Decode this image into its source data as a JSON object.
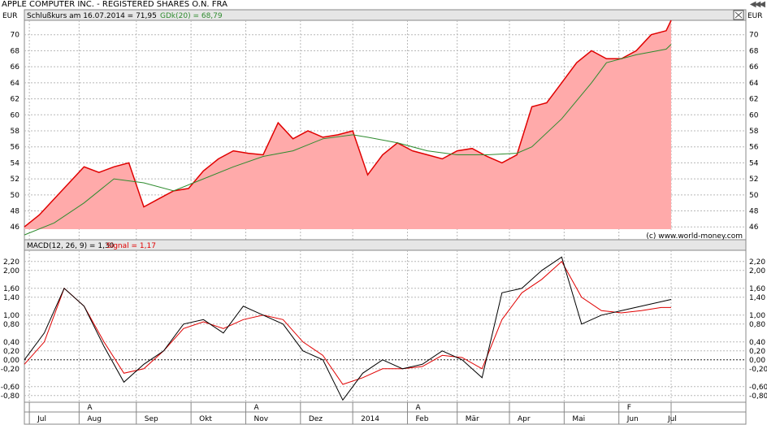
{
  "window": {
    "title": "APPLE COMPUTER INC. - REGISTERED SHARES O.N. FRA"
  },
  "icons": {
    "nav": "triple-chevron-left-icon",
    "close": "close-box-icon"
  },
  "chart_data": [
    {
      "type": "area",
      "currency_label": "EUR",
      "legend": {
        "close_label": "Schlußkurs am 16.07.2014 = 71,95",
        "ma_label": "GDk(20) = 68,79"
      },
      "credit": "(c) www.world-money.com",
      "yticks": [
        "46",
        "48",
        "50",
        "52",
        "54",
        "56",
        "58",
        "60",
        "62",
        "64",
        "66",
        "68",
        "70"
      ],
      "yvalues": [
        46,
        48,
        50,
        52,
        54,
        56,
        58,
        60,
        62,
        64,
        66,
        68,
        70
      ],
      "ylim": [
        44.4,
        71.8
      ],
      "x_index_range": [
        0,
        260
      ],
      "colors": {
        "close_line": "#e00000",
        "close_fill": "#ffaaaa",
        "ma_line": "#2e8b2e"
      },
      "series": [
        {
          "name": "Schlußkurs",
          "x": [
            0,
            6,
            12,
            18,
            24,
            30,
            36,
            42,
            48,
            54,
            60,
            66,
            72,
            78,
            84,
            90,
            96,
            102,
            108,
            114,
            120,
            126,
            132,
            138,
            144,
            150,
            156,
            162,
            168,
            174,
            180,
            186,
            192,
            198,
            204,
            210,
            216,
            222,
            228,
            234,
            240,
            246,
            252,
            258,
            260
          ],
          "values": [
            46.0,
            47.5,
            49.5,
            51.5,
            53.5,
            52.8,
            53.5,
            54.0,
            48.5,
            49.5,
            50.5,
            50.8,
            53.0,
            54.5,
            55.5,
            55.2,
            55.0,
            59.0,
            57.0,
            58.0,
            57.2,
            57.5,
            58.0,
            52.5,
            55.0,
            56.5,
            55.5,
            55.0,
            54.5,
            55.5,
            55.8,
            54.8,
            54.0,
            55.0,
            61.0,
            61.5,
            64.0,
            66.5,
            68.0,
            67.0,
            67.0,
            68.0,
            70.0,
            70.5,
            71.8
          ]
        },
        {
          "name": "GDk(20)",
          "x": [
            0,
            12,
            24,
            36,
            48,
            60,
            72,
            84,
            96,
            108,
            120,
            132,
            138,
            150,
            162,
            174,
            186,
            198,
            204,
            216,
            228,
            234,
            246,
            258,
            260
          ],
          "values": [
            45.0,
            46.5,
            49.0,
            52.0,
            51.5,
            50.5,
            52.0,
            53.5,
            54.8,
            55.5,
            57.0,
            57.5,
            57.2,
            56.5,
            55.5,
            55.0,
            55.0,
            55.2,
            56.0,
            59.5,
            64.0,
            66.5,
            67.5,
            68.2,
            68.8
          ]
        }
      ]
    },
    {
      "type": "line",
      "legend": {
        "macd_label": "MACD(12, 26, 9) = 1,30",
        "signal_label": "Signal = 1,17"
      },
      "yticks": [
        "-0,80",
        "-0,60",
        "-0,20",
        "0,00",
        "0,20",
        "0,40",
        "0,80",
        "1,00",
        "1,40",
        "1,60",
        "2,00",
        "2,20"
      ],
      "yvalues": [
        -0.8,
        -0.6,
        -0.2,
        0.0,
        0.2,
        0.4,
        0.8,
        1.0,
        1.4,
        1.6,
        2.0,
        2.2
      ],
      "ylim": [
        -0.95,
        2.45
      ],
      "x_index_range": [
        0,
        260
      ],
      "colors": {
        "macd_line": "#000000",
        "signal_line": "#e00000"
      },
      "series": [
        {
          "name": "MACD",
          "x": [
            0,
            8,
            16,
            24,
            32,
            40,
            48,
            56,
            64,
            72,
            80,
            88,
            96,
            104,
            112,
            120,
            128,
            136,
            144,
            152,
            160,
            168,
            176,
            184,
            192,
            200,
            208,
            216,
            224,
            232,
            240,
            248,
            256,
            260
          ],
          "values": [
            0.0,
            0.6,
            1.6,
            1.2,
            0.3,
            -0.5,
            -0.1,
            0.2,
            0.8,
            0.9,
            0.6,
            1.2,
            1.0,
            0.8,
            0.2,
            0.0,
            -0.9,
            -0.3,
            0.0,
            -0.2,
            -0.1,
            0.2,
            0.0,
            -0.4,
            1.5,
            1.6,
            2.0,
            2.3,
            0.8,
            1.0,
            1.1,
            1.2,
            1.3,
            1.35
          ]
        },
        {
          "name": "Signal",
          "x": [
            0,
            8,
            16,
            24,
            32,
            40,
            48,
            56,
            64,
            72,
            80,
            88,
            96,
            104,
            112,
            120,
            128,
            136,
            144,
            152,
            160,
            168,
            176,
            184,
            192,
            200,
            208,
            216,
            224,
            232,
            240,
            248,
            256,
            260
          ],
          "values": [
            -0.1,
            0.4,
            1.6,
            1.2,
            0.4,
            -0.3,
            -0.2,
            0.2,
            0.7,
            0.85,
            0.7,
            0.9,
            1.0,
            0.9,
            0.4,
            0.1,
            -0.55,
            -0.4,
            -0.2,
            -0.2,
            -0.15,
            0.1,
            0.05,
            -0.2,
            0.9,
            1.5,
            1.8,
            2.2,
            1.4,
            1.1,
            1.05,
            1.1,
            1.17,
            1.17
          ]
        }
      ]
    }
  ],
  "time_axis": {
    "months": [
      {
        "label": "Jul",
        "x": 2
      },
      {
        "label": "Aug",
        "x": 22
      },
      {
        "label": "Sep",
        "x": 45
      },
      {
        "label": "Okt",
        "x": 67
      },
      {
        "label": "Nov",
        "x": 89
      },
      {
        "label": "Dez",
        "x": 111
      },
      {
        "label": "2014",
        "x": 132
      },
      {
        "label": "Feb",
        "x": 154
      },
      {
        "label": "Mär",
        "x": 174
      },
      {
        "label": "Apr",
        "x": 195
      },
      {
        "label": "Mai",
        "x": 217
      },
      {
        "label": "Jun",
        "x": 239
      },
      {
        "label": "Jul",
        "x": 260
      }
    ],
    "event_markers": [
      {
        "label": "A",
        "x": 22
      },
      {
        "label": "A",
        "x": 89
      },
      {
        "label": "A",
        "x": 154
      },
      {
        "label": "F",
        "x": 239
      }
    ]
  }
}
